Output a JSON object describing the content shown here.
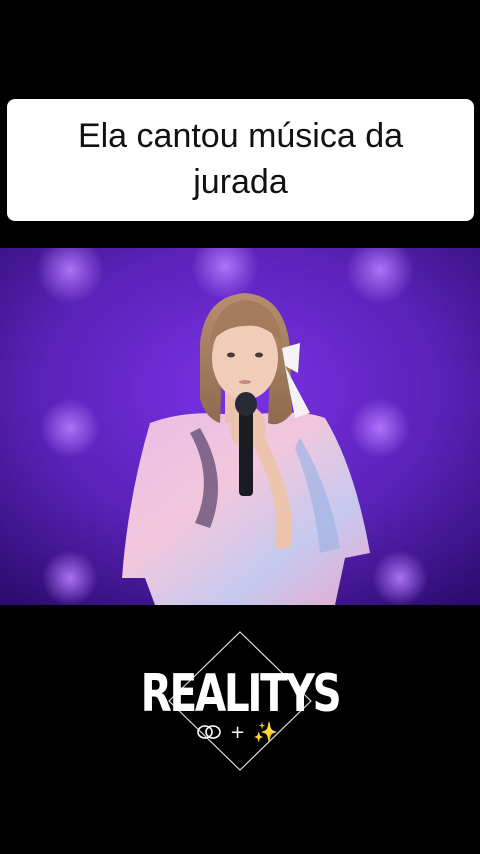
{
  "caption": {
    "text": "Ela cantou música da jurada"
  },
  "video": {
    "scene": "girl-singing-on-stage",
    "colors": {
      "stage_purple": "#4a1aa0",
      "stage_glow": "#8a3cf0",
      "dress_pink": "#e9b8e0",
      "dress_blue": "#b9c8ee"
    }
  },
  "watermark": {
    "brand": "REALITYS",
    "icons": [
      "rings-icon",
      "plus-icon",
      "sparkles-icon"
    ],
    "glyph_plus": "+",
    "glyph_sparkles": "✨"
  }
}
